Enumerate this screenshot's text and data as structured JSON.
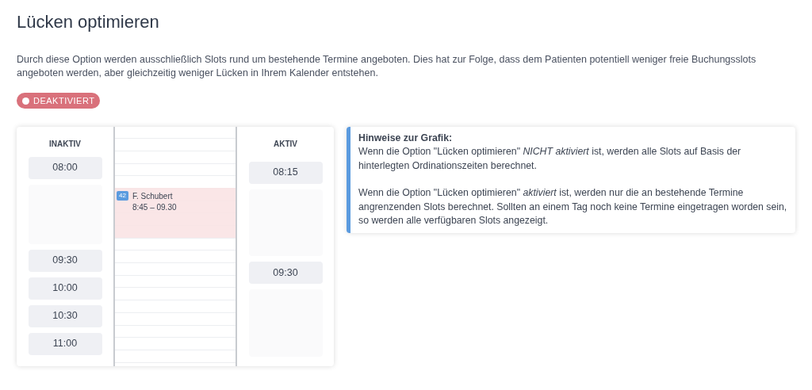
{
  "title": "Lücken optimieren",
  "description": "Durch diese Option werden ausschließlich Slots rund um bestehende Termine angeboten. Dies hat zur Folge, dass dem Patienten potentiell weniger freie Buchungsslots angeboten werden, aber gleichzeitig weniger Lücken in Ihrem Kalender entstehen.",
  "status": {
    "label": "DEAKTIVIERT",
    "on": false
  },
  "graphic": {
    "inactive": {
      "heading": "INAKTIV",
      "slots": [
        {
          "kind": "time",
          "time": "08:00"
        },
        {
          "kind": "gap"
        },
        {
          "kind": "time",
          "time": "09:30"
        },
        {
          "kind": "time",
          "time": "10:00"
        },
        {
          "kind": "time",
          "time": "10:30"
        },
        {
          "kind": "time",
          "time": "11:00"
        }
      ]
    },
    "calendar": {
      "appointment": {
        "number": "42",
        "name": "F. Schubert",
        "time": "8:45 – 09.30"
      }
    },
    "active": {
      "heading": "AKTIV",
      "slots": [
        {
          "kind": "time",
          "time": "08:15"
        },
        {
          "kind": "gap"
        },
        {
          "kind": "time",
          "time": "09:30"
        },
        {
          "kind": "gap"
        }
      ]
    }
  },
  "hint": {
    "title": "Hinweise zur Grafik:",
    "paragraphs": [
      "Wenn die Option \"Lücken optimieren\" *NICHT aktiviert* ist, werden alle Slots auf Basis der hinterlegten Ordinationszeiten berechnet.",
      "Wenn die Option \"Lücken optimieren\" *aktiviert* ist, werden nur die an bestehende Termine angrenzenden Slots berechnet. Sollten an einem Tag noch keine Termine eingetragen worden sein, so werden alle verfügbaren Slots angezeigt."
    ]
  }
}
